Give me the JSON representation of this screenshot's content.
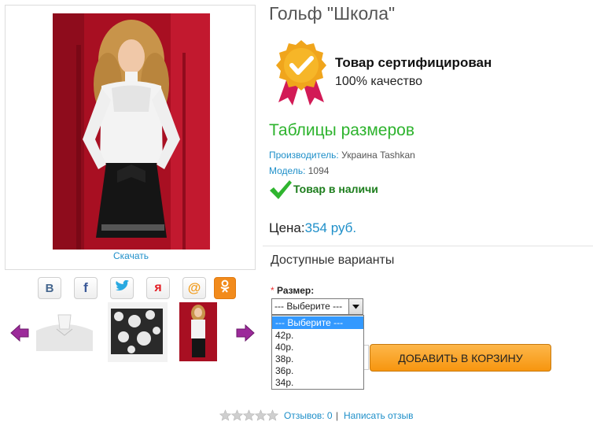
{
  "product": {
    "title": "Гольф \"Школа\"",
    "download_label": "Скачать",
    "certificate": {
      "title": "Товар сертифицирован",
      "subtitle": "100% качество"
    },
    "size_table_link": "Таблицы размеров",
    "manufacturer_label": "Производитель:",
    "manufacturer_value": "Украина Tashkan",
    "model_label": "Модель:",
    "model_value": "1094",
    "stock_status": "Товар в наличи",
    "price_label": "Цена:",
    "price_value": "354 руб."
  },
  "share_icons": [
    "vk-icon",
    "facebook-icon",
    "twitter-icon",
    "yaru-icon",
    "mailru-icon",
    "odnoklassniki-icon"
  ],
  "variants": {
    "heading": "Доступные варианты",
    "required_mark": "*",
    "size_label": "Размер:",
    "selected": "--- Выберите ---",
    "options": [
      "--- Выберите ---",
      "42р.",
      "40р.",
      "38р.",
      "36р.",
      "34р."
    ]
  },
  "cart": {
    "add_label": "ДОБАВИТЬ В КОРЗИНУ"
  },
  "reviews": {
    "rating": 0,
    "count_label": "Отзывов: 0",
    "separator": "|",
    "write_label": "Написать отзыв"
  },
  "colors": {
    "link": "#1e8fc9",
    "green": "#2db32d",
    "button_orange": "#f7960f",
    "arrow_purple": "#9c2a9a",
    "dress_red": "#b3142a"
  }
}
